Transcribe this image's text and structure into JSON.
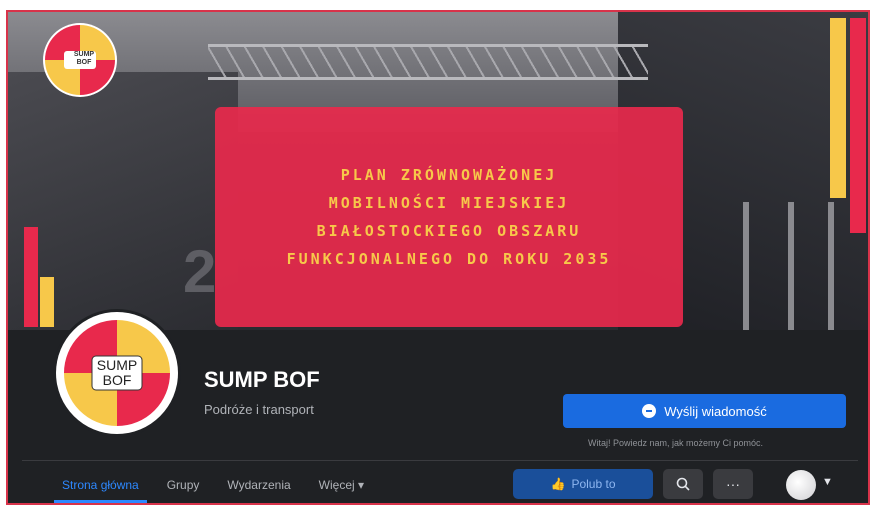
{
  "cover": {
    "banner_lines": [
      "PLAN ZRÓWNOWAŻONEJ",
      "MOBILNOŚCI MIEJSKIEJ",
      "BIAŁOSTOCKIEGO OBSZARU",
      "FUNKCJONALNEGO DO ROKU 2035"
    ],
    "station_sign": "2"
  },
  "logo": {
    "text_line1": "SUMP",
    "text_line2": "BOF"
  },
  "page": {
    "name": "SUMP BOF",
    "category": "Podróże i transport"
  },
  "actions": {
    "send_message_label": "Wyślij wiadomość",
    "hint": "Witaj! Powiedz nam, jak możemy Ci pomóc.",
    "like_label": "Polub to"
  },
  "nav": {
    "tabs": [
      "Strona główna",
      "Grupy",
      "Wydarzenia",
      "Więcej ▾"
    ],
    "active_index": 0
  },
  "colors": {
    "brand_red": "#e8294c",
    "brand_yellow": "#f7c84a",
    "facebook_blue": "#1a6be0"
  },
  "icons": [
    "search-icon",
    "more-icon",
    "messenger-icon",
    "like-icon",
    "avatar",
    "chevron-down-icon"
  ]
}
